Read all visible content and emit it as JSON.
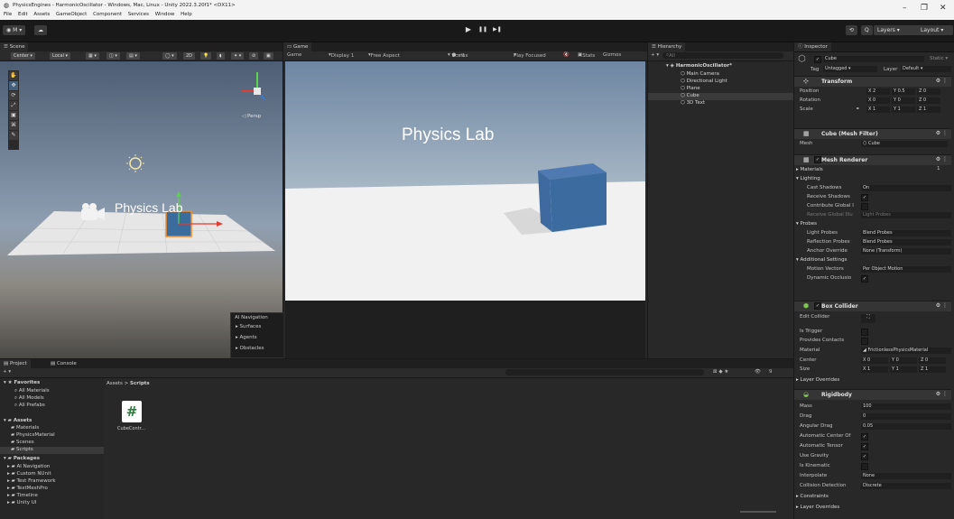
{
  "window": {
    "title": "PhysicsEngines - HarmonicOscillator - Windows, Mac, Linux - Unity 2022.3.20f1* <DX11>",
    "menu": [
      "File",
      "Edit",
      "Assets",
      "GameObject",
      "Component",
      "Services",
      "Window",
      "Help"
    ],
    "controls": [
      "–",
      "❐",
      "✕"
    ]
  },
  "toolbar": {
    "account": "◉ M ▾",
    "cloud": "☁",
    "play": "▶",
    "pause": "❚❚",
    "step": "▶❚",
    "history": "⟲",
    "search": "Q",
    "layers": "Layers",
    "layout": "Layout"
  },
  "scene": {
    "tab": "Scene",
    "toolbar": {
      "center": "Center ▾",
      "local": "Local ▾",
      "mode_2d": "2D"
    },
    "persp": "◁ Persp",
    "world_text": "Physics Lab",
    "tools": [
      "✋",
      "✥",
      "⟳",
      "⤢",
      "▣",
      "⌘",
      "✎"
    ]
  },
  "ai_navigation": {
    "title": "AI Navigation",
    "items": [
      "Surfaces",
      "Agents",
      "Obstacles"
    ]
  },
  "game": {
    "tab": "Game",
    "toolbar": {
      "mode": "Game",
      "display": "Display 1",
      "aspect": "Free Aspect",
      "scale_label": "Scale",
      "scale_value": "1x",
      "play_mode": "Play Focused",
      "stats": "Stats",
      "gizmos": "Gizmos"
    },
    "world_text": "Physics Lab"
  },
  "hierarchy": {
    "tab": "Hierarchy",
    "add": "+ ▾",
    "search_placeholder": "All",
    "root": "HarmonicOscillator*",
    "items": [
      "Main Camera",
      "Directional Light",
      "Plane",
      "Cube",
      "3D Text"
    ]
  },
  "inspector": {
    "tab": "Inspector",
    "object_name": "Cube",
    "static": "Static",
    "tag_label": "Tag",
    "tag": "Untagged",
    "layer_label": "Layer",
    "layer": "Default",
    "transform": {
      "title": "Transform",
      "position": {
        "label": "Position",
        "x": "2",
        "y": "0.5",
        "z": "0"
      },
      "rotation": {
        "label": "Rotation",
        "x": "0",
        "y": "0",
        "z": "0"
      },
      "scale": {
        "label": "Scale",
        "x": "1",
        "y": "1",
        "z": "1"
      }
    },
    "mesh_filter": {
      "title": "Cube (Mesh Filter)",
      "mesh_label": "Mesh",
      "mesh": "Cube"
    },
    "mesh_renderer": {
      "title": "Mesh Renderer",
      "materials_label": "Materials",
      "materials_count": "1",
      "lighting": "Lighting",
      "cast_shadows_label": "Cast Shadows",
      "cast_shadows": "On",
      "receive_shadows_label": "Receive Shadows",
      "contribute_gi_label": "Contribute Global I",
      "receive_gi_label": "Receive Global Illu",
      "receive_gi": "Light Probes",
      "probes": "Probes",
      "light_probes_label": "Light Probes",
      "light_probes": "Blend Probes",
      "reflection_probes_label": "Reflection Probes",
      "reflection_probes": "Blend Probes",
      "anchor_override_label": "Anchor Override",
      "anchor_override": "None (Transform)",
      "additional": "Additional Settings",
      "motion_vectors_label": "Motion Vectors",
      "motion_vectors": "Per Object Motion",
      "dynamic_occlusion_label": "Dynamic Occlusio"
    },
    "box_collider": {
      "title": "Box Collider",
      "edit_collider": "Edit Collider",
      "is_trigger": "Is Trigger",
      "provides_contacts": "Provides Contacts",
      "material_label": "Material",
      "material": "FrictionlessPhysicsMaterial",
      "center": {
        "label": "Center",
        "x": "0",
        "y": "0",
        "z": "0"
      },
      "size": {
        "label": "Size",
        "x": "1",
        "y": "1",
        "z": "1"
      },
      "layer_overrides": "Layer Overrides"
    },
    "rigidbody": {
      "title": "Rigidbody",
      "mass_label": "Mass",
      "mass": "100",
      "drag_label": "Drag",
      "drag": "0",
      "angular_drag_label": "Angular Drag",
      "angular_drag": "0.05",
      "auto_center_label": "Automatic Center Of",
      "auto_tensor_label": "Automatic Tensor",
      "use_gravity_label": "Use Gravity",
      "is_kinematic_label": "Is Kinematic",
      "interpolate_label": "Interpolate",
      "interpolate": "None",
      "collision_label": "Collision Detection",
      "collision": "Discrete",
      "constraints": "Constraints",
      "layer_overrides": "Layer Overrides"
    }
  },
  "project": {
    "tab_project": "Project",
    "tab_console": "Console",
    "add": "+ ▾",
    "favorites": "Favorites",
    "fav_items": [
      "All Materials",
      "All Models",
      "All Prefabs"
    ],
    "assets": "Assets",
    "asset_items": [
      "Materials",
      "PhysicsMaterial",
      "Scenes",
      "Scripts"
    ],
    "packages": "Packages",
    "package_items": [
      "AI Navigation",
      "Custom NUnit",
      "Test Framework",
      "TextMeshPro",
      "Timeline",
      "Unity UI"
    ],
    "breadcrumb_root": "Assets",
    "breadcrumb_current": "Scripts",
    "file_name": "CubeContr...",
    "file_glyph": "#",
    "badge": "9"
  }
}
